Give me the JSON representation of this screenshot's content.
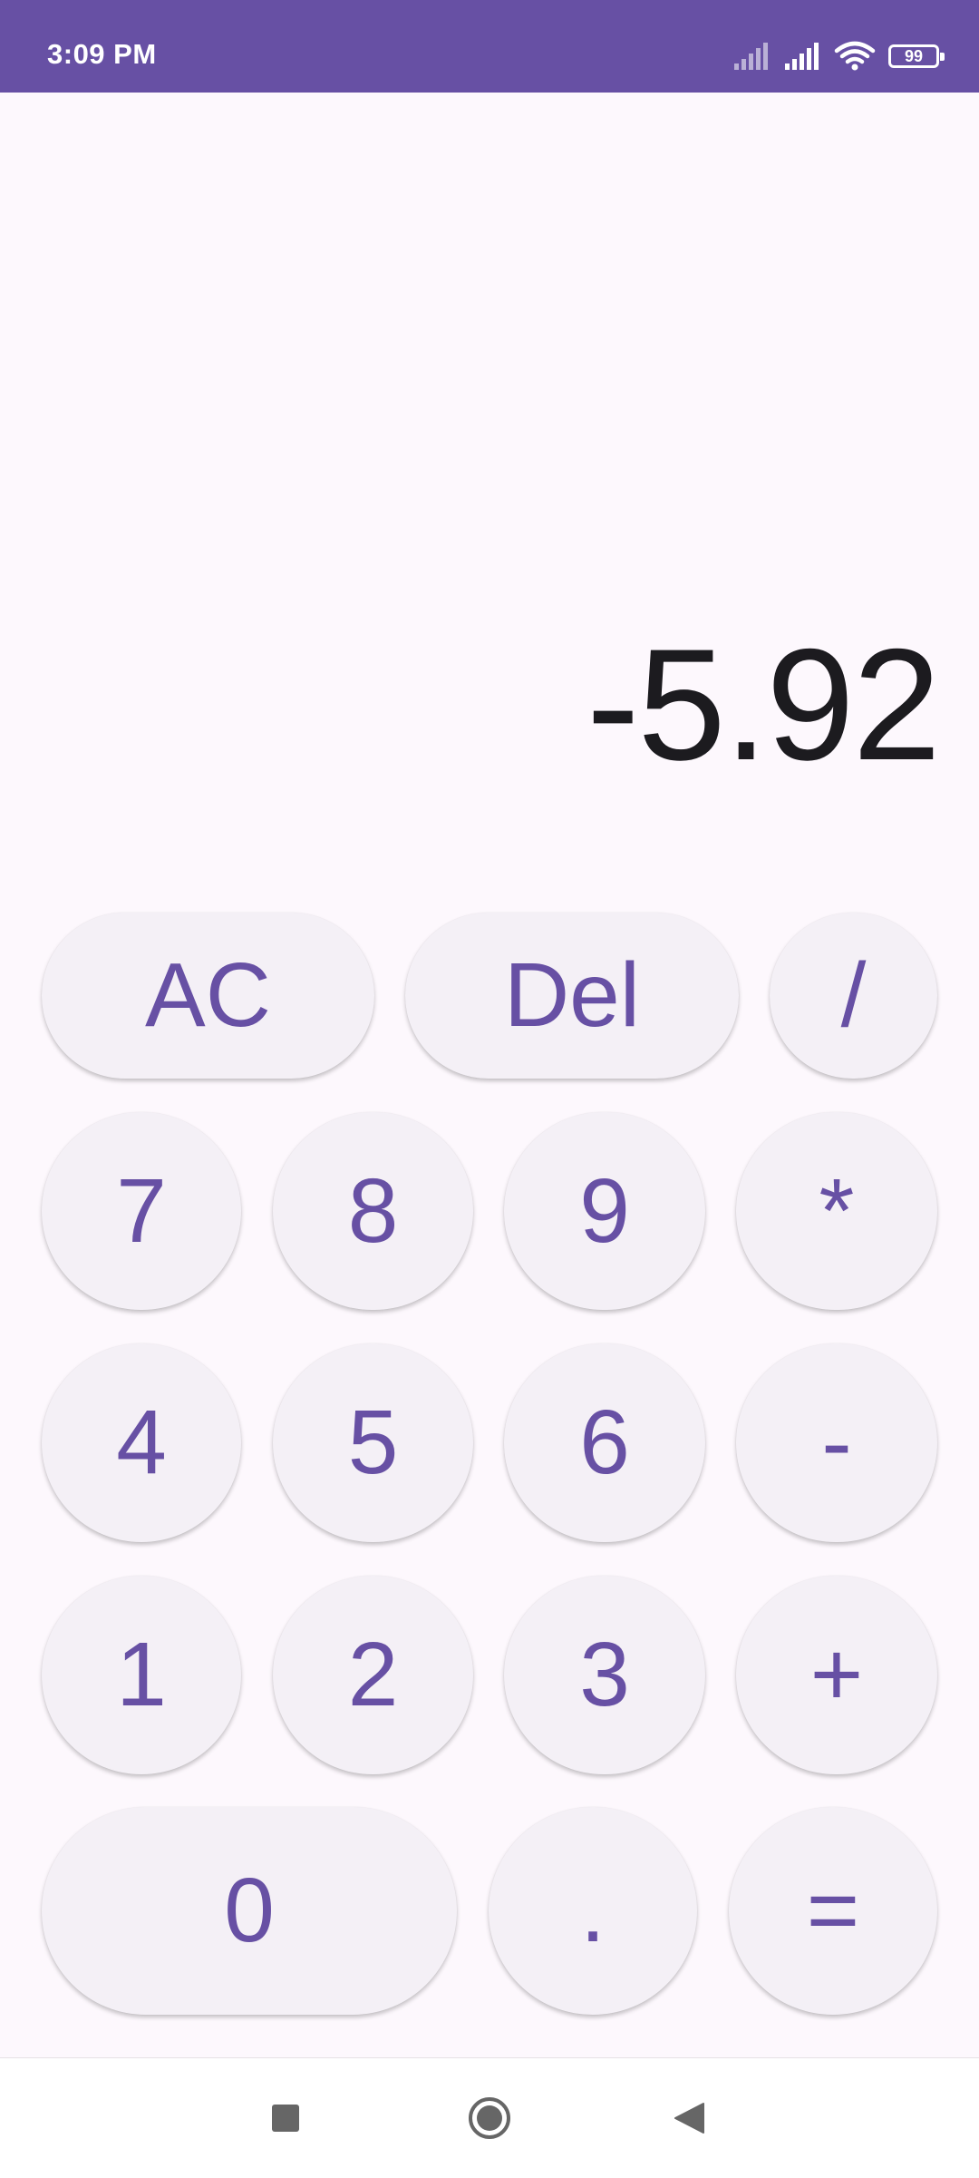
{
  "status_bar": {
    "time": "3:09 PM",
    "battery_level": "99",
    "icons": [
      "signal-icon",
      "signal-icon",
      "wifi-icon",
      "battery-icon"
    ]
  },
  "display": {
    "value": "-5.92"
  },
  "keys": {
    "ac": "AC",
    "del": "Del",
    "divide": "/",
    "seven": "7",
    "eight": "8",
    "nine": "9",
    "multiply": "*",
    "four": "4",
    "five": "5",
    "six": "6",
    "minus": "-",
    "one": "1",
    "two": "2",
    "three": "3",
    "plus": "+",
    "zero": "0",
    "dot": ".",
    "equals": "="
  },
  "nav_bar": {
    "icons": [
      "recents-square-icon",
      "home-circle-icon",
      "back-triangle-icon"
    ]
  },
  "colors": {
    "accent": "#6750a4",
    "background": "#fdf8fd",
    "key_background": "#f4f0f6",
    "display_text": "#1c1b1f"
  }
}
